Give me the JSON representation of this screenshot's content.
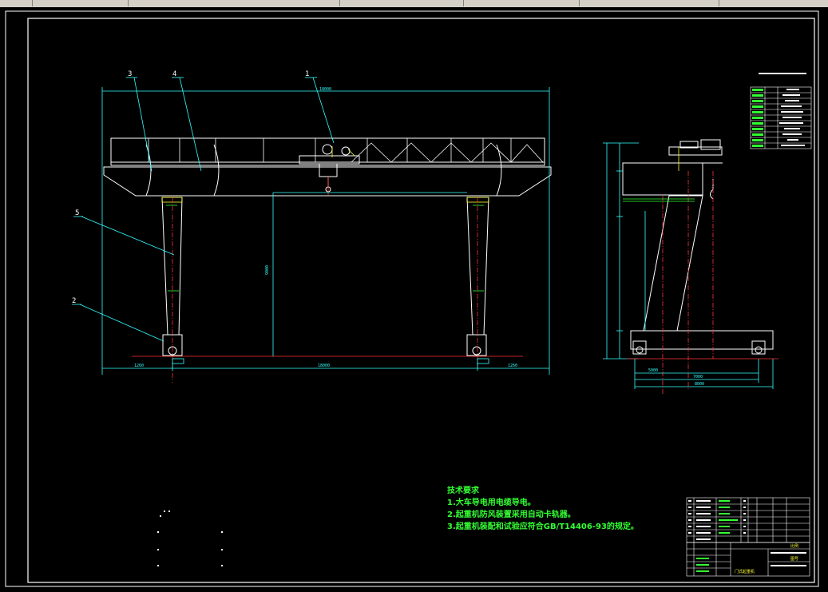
{
  "app": {
    "toolbar_colors": {
      "bg": "#d4d0c8",
      "border": "#808080"
    }
  },
  "drawing": {
    "colors": {
      "frame": "#ffffff",
      "structure": "#ffffff",
      "dimension": "#33ffff",
      "centerline": "#ff3333",
      "green": "#33ff33",
      "yellow": "#ffff33"
    },
    "callouts": [
      "1",
      "2",
      "3",
      "4",
      "5"
    ],
    "tech_requirements": {
      "title": "技术要求",
      "items": [
        "1.大车导电用电缆导电。",
        "2.起重机防风装置采用自动卡轨器。",
        "3.起重机装配和试验应符合GB/T14406-93的规定。"
      ]
    },
    "dims_front": {
      "span": "18000",
      "left": "1260",
      "right": "1260",
      "height": "9000"
    },
    "dims_side": {
      "base1": "5000",
      "base2": "7000",
      "base3": "8000"
    },
    "title_block": {
      "cells": [
        "比例",
        "图号",
        "门式起重机"
      ]
    }
  }
}
